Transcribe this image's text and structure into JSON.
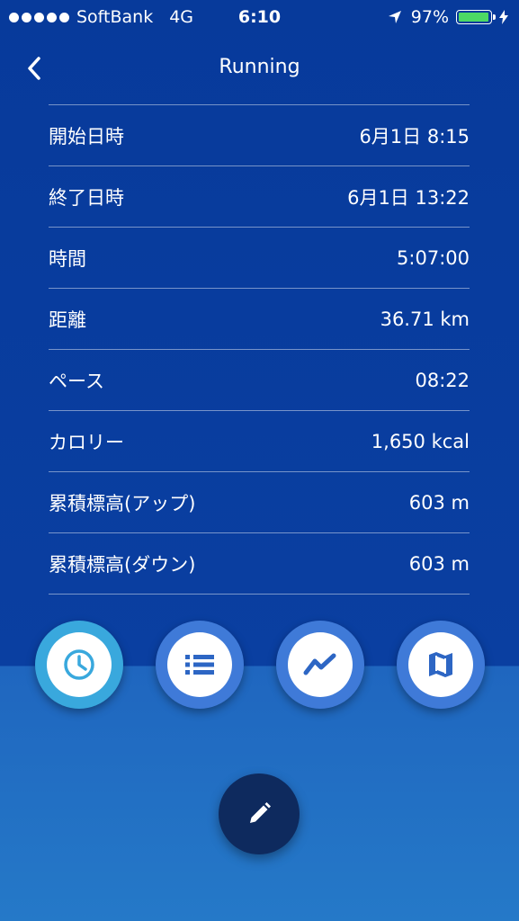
{
  "status_bar": {
    "carrier": "SoftBank",
    "network": "4G",
    "time": "6:10",
    "battery_percent": "97%",
    "battery_level": 0.97,
    "battery_color": "#4cd964"
  },
  "nav": {
    "title": "Running",
    "back_icon": "chevron-left-icon"
  },
  "details": [
    {
      "label": "開始日時",
      "value": "6月1日 8:15"
    },
    {
      "label": "終了日時",
      "value": "6月1日 13:22"
    },
    {
      "label": "時間",
      "value": "5:07:00"
    },
    {
      "label": "距離",
      "value": "36.71 km"
    },
    {
      "label": "ペース",
      "value": "08:22"
    },
    {
      "label": "カロリー",
      "value": "1,650 kcal"
    },
    {
      "label": "累積標高(アップ)",
      "value": "603 m"
    },
    {
      "label": "累積標高(ダウン)",
      "value": "603 m"
    }
  ],
  "actions": [
    {
      "name": "summary",
      "icon": "clock-icon",
      "active": true
    },
    {
      "name": "laps",
      "icon": "list-icon",
      "active": false
    },
    {
      "name": "graph",
      "icon": "chart-line-icon",
      "active": false
    },
    {
      "name": "map",
      "icon": "map-icon",
      "active": false
    }
  ],
  "edit": {
    "icon": "pencil-icon"
  },
  "colors": {
    "background_top": "#0a3fa1",
    "background_bottom": "#2579c8",
    "button_ring": "#3f7ad8",
    "button_ring_active": "#39a8dd",
    "icon_color": "#2d66c4",
    "edit_button": "#0e2a5e"
  }
}
